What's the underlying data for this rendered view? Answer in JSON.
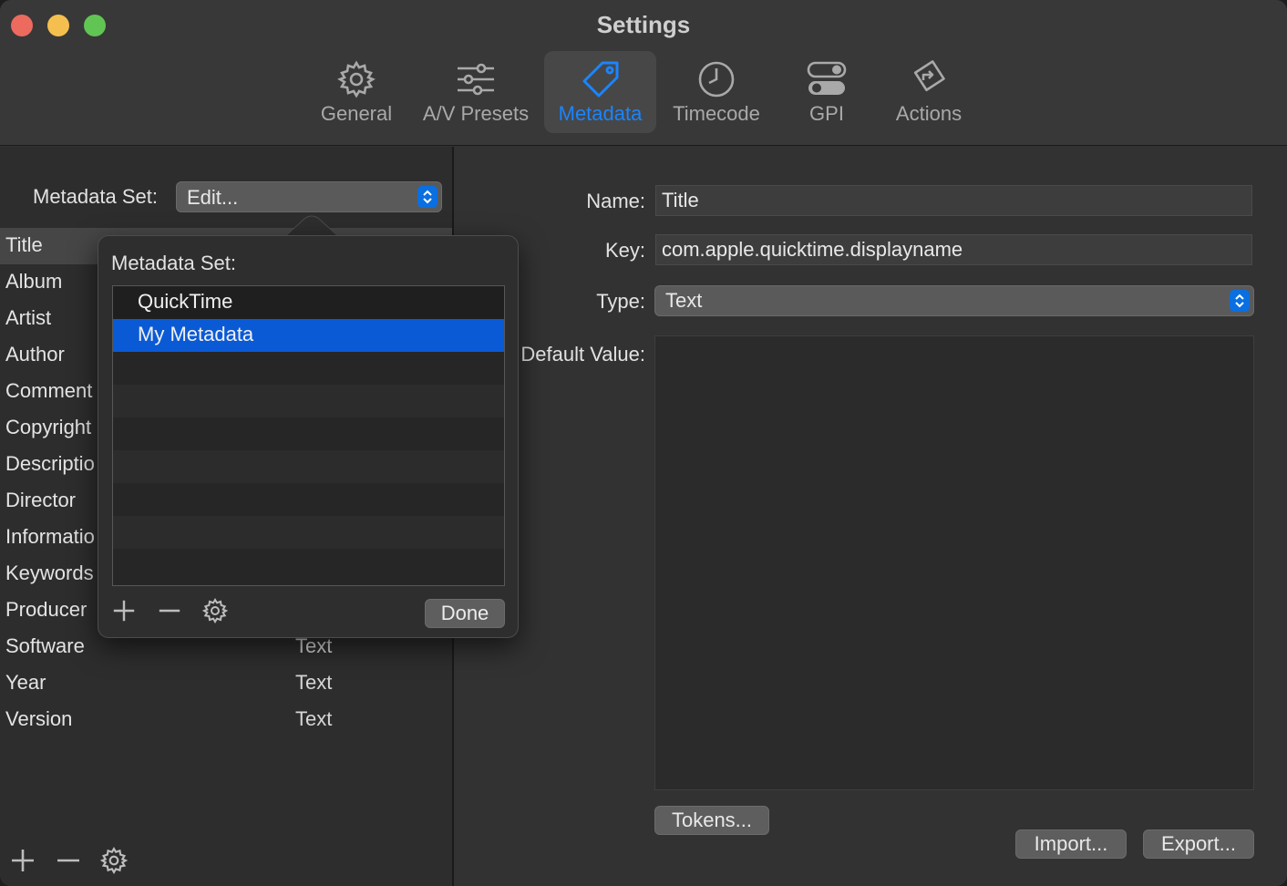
{
  "window": {
    "title": "Settings"
  },
  "toolbar": {
    "tabs": [
      {
        "label": "General",
        "icon": "gear-icon"
      },
      {
        "label": "A/V Presets",
        "icon": "sliders-icon"
      },
      {
        "label": "Metadata",
        "icon": "tag-icon",
        "active": true
      },
      {
        "label": "Timecode",
        "icon": "clock-icon"
      },
      {
        "label": "GPI",
        "icon": "toggles-icon"
      },
      {
        "label": "Actions",
        "icon": "diamond-arrow-icon"
      }
    ]
  },
  "left": {
    "set_label": "Metadata Set:",
    "set_value": "Edit...",
    "rows": [
      {
        "name": "Title",
        "type": ""
      },
      {
        "name": "Album",
        "type": ""
      },
      {
        "name": "Artist",
        "type": ""
      },
      {
        "name": "Author",
        "type": ""
      },
      {
        "name": "Comment",
        "type": ""
      },
      {
        "name": "Copyright",
        "type": ""
      },
      {
        "name": "Descriptio",
        "type": ""
      },
      {
        "name": "Director",
        "type": ""
      },
      {
        "name": "Informatio",
        "type": ""
      },
      {
        "name": "Keywords",
        "type": ""
      },
      {
        "name": "Producer",
        "type": ""
      },
      {
        "name": "Software",
        "type": "Text"
      },
      {
        "name": "Year",
        "type": "Text"
      },
      {
        "name": "Version",
        "type": "Text"
      }
    ]
  },
  "popover": {
    "title": "Metadata Set:",
    "items": [
      "QuickTime",
      "My Metadata"
    ],
    "selected_index": 1,
    "done_label": "Done"
  },
  "right": {
    "name_label": "Name:",
    "name_value": "Title",
    "key_label": "Key:",
    "key_value": "com.apple.quicktime.displayname",
    "type_label": "Type:",
    "type_value": "Text",
    "default_label": "Default Value:",
    "tokens_label": "Tokens...",
    "import_label": "Import...",
    "export_label": "Export..."
  },
  "colors": {
    "accent": "#1a85ff",
    "selection": "#0a5ad6"
  }
}
